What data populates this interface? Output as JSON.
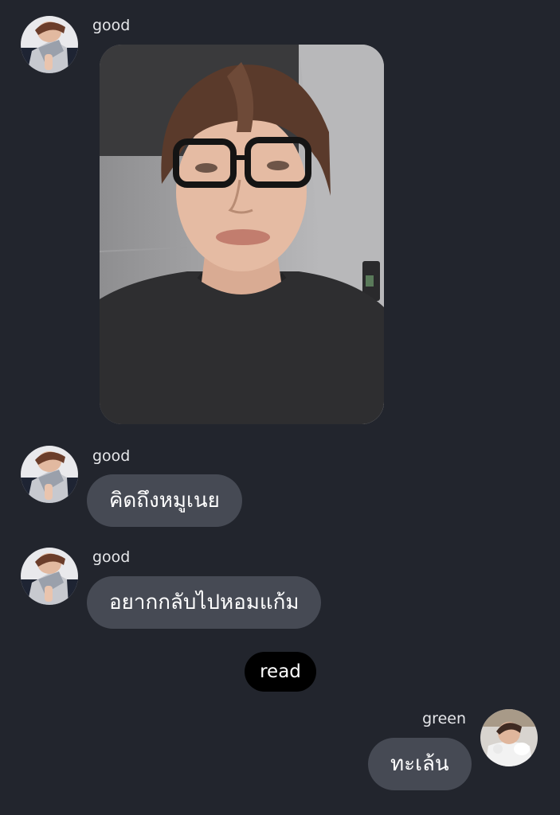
{
  "theme": {
    "background": "#22252d",
    "bubble_color": "#464a54",
    "read_pill_color": "#000000"
  },
  "messages": [
    {
      "sender": "good",
      "type": "image",
      "image_description": "selfie-photo"
    },
    {
      "sender": "good",
      "type": "text",
      "text": "คิดถึงหมูเนย"
    },
    {
      "sender": "good",
      "type": "text",
      "text": "อยากกลับไปหอมแก้ม"
    },
    {
      "sender": "green",
      "type": "text",
      "text": "ทะเล้น"
    }
  ],
  "status": {
    "read_label": "read"
  }
}
